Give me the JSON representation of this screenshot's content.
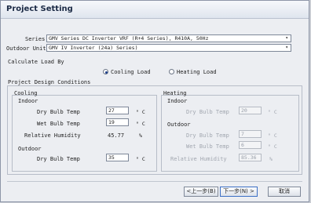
{
  "window": {
    "title": "Project Setting"
  },
  "series": {
    "label": "Series",
    "value": "GMV Series DC Inverter VRF (R+4 Series), R410A, 50Hz"
  },
  "outdoor_unit": {
    "label": "Outdoor Unit",
    "value": "GMV IV Inverter (24a) Series)"
  },
  "calculate_load_by": {
    "label": "Calculate Load By",
    "options": [
      {
        "label": "Cooling Load",
        "selected": true
      },
      {
        "label": "Heating Load",
        "selected": false
      }
    ]
  },
  "conditions": {
    "title": "Project Design Conditions",
    "cooling": {
      "title": "Cooling",
      "indoor": {
        "title": "Indoor",
        "dry_bulb": {
          "label": "Dry Bulb Temp",
          "value": "27",
          "unit": "° C"
        },
        "wet_bulb": {
          "label": "Wet Bulb Temp",
          "value": "19",
          "unit": "° C"
        },
        "humidity": {
          "label": "Relative Humidity",
          "value": "45.77",
          "unit": "%"
        }
      },
      "outdoor": {
        "title": "Outdoor",
        "dry_bulb": {
          "label": "Dry Bulb Temp",
          "value": "35",
          "unit": "° C"
        }
      }
    },
    "heating": {
      "title": "Heating",
      "indoor": {
        "title": "Indoor",
        "dry_bulb": {
          "label": "Dry Bulb Temp",
          "value": "20",
          "unit": "° C"
        }
      },
      "outdoor": {
        "title": "Outdoor",
        "dry_bulb": {
          "label": "Dry Bulb Temp",
          "value": "7",
          "unit": "° C"
        },
        "wet_bulb": {
          "label": "Wet Bulb Temp",
          "value": "6",
          "unit": "° C"
        },
        "humidity": {
          "label": "Relative Humidity",
          "value": "85.36",
          "unit": "%"
        }
      }
    }
  },
  "buttons": {
    "back": "<上一步(B)",
    "next": "下一步(N) >",
    "cancel": "取消"
  }
}
